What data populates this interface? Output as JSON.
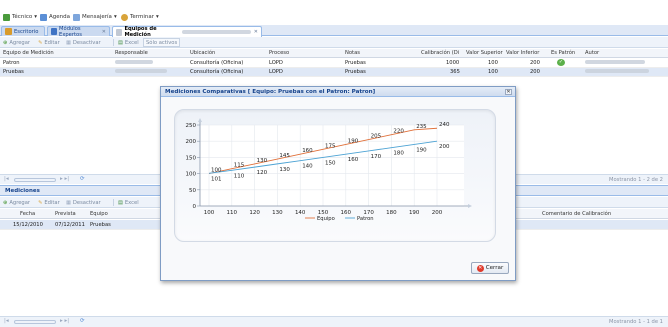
{
  "menu": {
    "tecnico": "Técnico",
    "agenda": "Agenda",
    "mensajeria": "Mensajería",
    "terminar": "Terminar"
  },
  "tabs": [
    {
      "label": "Escritorio"
    },
    {
      "label": "Módulos Expertos"
    },
    {
      "label": "Equipos de Medición"
    }
  ],
  "toolbar": {
    "agregar": "Agregar",
    "editar": "Editar",
    "desactivar": "Desactivar",
    "excel": "Excel",
    "solo_activos": "Sólo activos"
  },
  "grid": {
    "headers": [
      "Equipo de Medición",
      "Responsable",
      "Ubicación",
      "Proceso",
      "Notas",
      "Calibración (Di",
      "Valor Superior",
      "Valor Inferior",
      "Es Patrón",
      "Autor"
    ],
    "rows": [
      {
        "equipo": "Patron",
        "ubicacion": "Consultoría (Oficina)",
        "proceso": "LOPD",
        "notas": "Pruebas",
        "calibracion": "1000",
        "superior": "100",
        "inferior": "200"
      },
      {
        "equipo": "Pruebas",
        "ubicacion": "Consultoría (Oficina)",
        "proceso": "LOPD",
        "notas": "Pruebas",
        "calibracion": "365",
        "superior": "100",
        "inferior": "200"
      }
    ],
    "paging_text": "Mostrando 1 - 2 de 2"
  },
  "mediciones": {
    "title": "Mediciones",
    "headers": [
      "Fecha",
      "Prevista",
      "Equipo",
      "Comentario de Calibración"
    ],
    "row": {
      "fecha": "15/12/2010",
      "prevista": "07/12/2011",
      "equipo": "Pruebas"
    },
    "paging_text": "Mostrando 1 - 1 de 1"
  },
  "modal": {
    "title": "Mediciones Comparativas [ Equipo: Pruebas con el Patron: Patron]",
    "close_label": "Cerrar"
  },
  "colors": {
    "equipo": "#e0703a",
    "patron": "#4da3d4"
  },
  "chart_data": {
    "type": "line",
    "x": [
      100,
      110,
      120,
      130,
      140,
      150,
      160,
      170,
      180,
      190,
      200
    ],
    "series": [
      {
        "name": "Equipo",
        "values": [
          100,
          115,
          130,
          145,
          160,
          175,
          190,
          205,
          220,
          235,
          240
        ]
      },
      {
        "name": "Patron",
        "values": [
          101,
          110,
          120,
          130,
          140,
          150,
          160,
          170,
          180,
          190,
          200
        ]
      }
    ],
    "xlabels": [
      "100",
      "110",
      "120",
      "130",
      "140",
      "150",
      "160",
      "170",
      "180",
      "190",
      "200"
    ],
    "yticks": [
      "0",
      "50",
      "100",
      "150",
      "200",
      "250"
    ],
    "ylim": [
      0,
      250
    ],
    "legend_position": "bottom"
  }
}
